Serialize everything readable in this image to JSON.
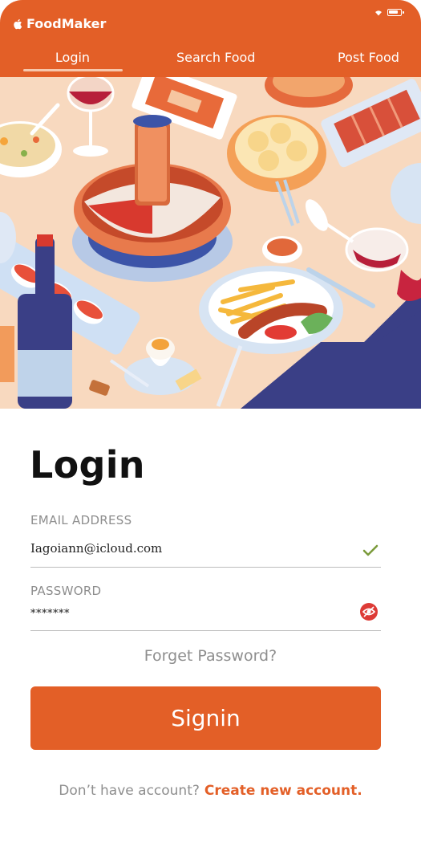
{
  "app": {
    "name": "FoodMaker",
    "icons": [
      "apple-icon",
      "wifi-icon",
      "battery-icon"
    ]
  },
  "tabs": [
    {
      "label": "Login",
      "active": true
    },
    {
      "label": "Search Food",
      "active": false
    },
    {
      "label": "Post Food",
      "active": false
    }
  ],
  "hero": {
    "icon": "food-table-illustration"
  },
  "form": {
    "title": "Login",
    "email_label": "EMAIL ADDRESS",
    "email_value": "Iagoiann@icloud.com",
    "email_status_icon": "check-icon",
    "password_label": "PASSWORD",
    "password_value": "*******",
    "password_toggle_icon": "eye-off-icon",
    "forget_label": "Forget Password?",
    "signin_label": "Signin",
    "signup_prompt": "Don’t have account?",
    "signup_link": "Create new account."
  },
  "colors": {
    "accent": "#e35f27",
    "muted_text": "#8e8e8e",
    "check": "#7a9a3a",
    "eye_icon": "#dd3b36"
  }
}
